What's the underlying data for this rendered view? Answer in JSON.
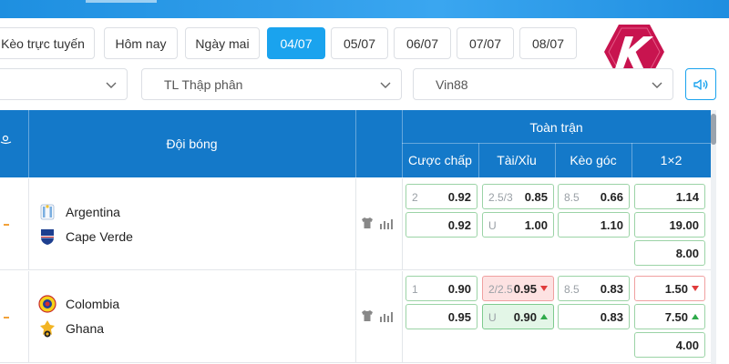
{
  "date_tabs": [
    {
      "label": "Kèo trực tuyến",
      "active": false
    },
    {
      "label": "Hôm nay",
      "active": false
    },
    {
      "label": "Ngày mai",
      "active": false
    },
    {
      "label": "04/07",
      "active": true
    },
    {
      "label": "05/07",
      "active": false
    },
    {
      "label": "06/07",
      "active": false
    },
    {
      "label": "07/07",
      "active": false
    },
    {
      "label": "08/07",
      "active": false
    }
  ],
  "logo": {
    "letter": "K",
    "color": "#c8144f"
  },
  "filters": {
    "first": "",
    "odds_type": "TL Thập phân",
    "bookmaker": "Vin88"
  },
  "table": {
    "team_header": "Đội bóng",
    "section_header": "Toàn trận",
    "columns": [
      "Cược chấp",
      "Tài/Xỉu",
      "Kèo góc",
      "1×2"
    ]
  },
  "matches": [
    {
      "home": "Argentina",
      "away": "Cape Verde",
      "handicap": [
        {
          "line": "2",
          "odd": "0.92"
        },
        {
          "line": "",
          "odd": "0.92"
        }
      ],
      "total": [
        {
          "line": "2.5/3",
          "odd": "0.85"
        },
        {
          "line": "U",
          "odd": "1.00"
        }
      ],
      "corner": [
        {
          "line": "8.5",
          "odd": "0.66"
        },
        {
          "line": "",
          "odd": "1.10"
        }
      ],
      "x12": [
        {
          "odd": "1.14"
        },
        {
          "odd": "19.00"
        },
        {
          "odd": "8.00"
        }
      ]
    },
    {
      "home": "Colombia",
      "away": "Ghana",
      "handicap": [
        {
          "line": "1",
          "odd": "0.90"
        },
        {
          "line": "",
          "odd": "0.95"
        }
      ],
      "total": [
        {
          "line": "2/2.5",
          "odd": "0.95",
          "trend": "down"
        },
        {
          "line": "U",
          "odd": "0.90",
          "trend": "up"
        }
      ],
      "corner": [
        {
          "line": "8.5",
          "odd": "0.83"
        },
        {
          "line": "",
          "odd": "0.83"
        }
      ],
      "x12": [
        {
          "odd": "1.50",
          "trend": "down"
        },
        {
          "odd": "7.50",
          "trend": "up"
        },
        {
          "odd": "4.00"
        }
      ]
    }
  ],
  "colors": {
    "accent": "#1aa3ee",
    "header": "#1479c9",
    "odd_down": "#e03b3b",
    "odd_up": "#2eaa4a"
  }
}
